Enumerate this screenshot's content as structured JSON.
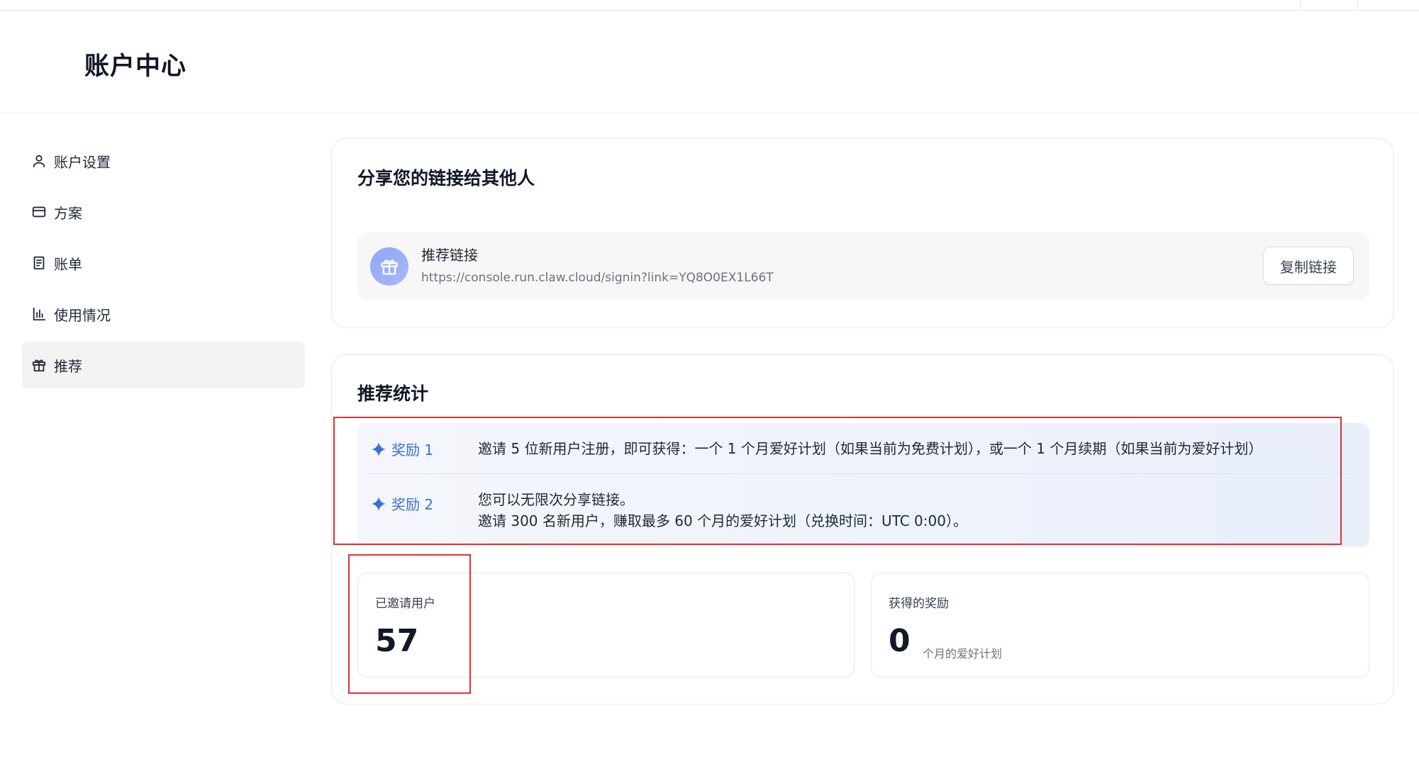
{
  "page": {
    "title": "账户中心"
  },
  "sidebar": {
    "items": [
      {
        "label": "账户设置",
        "icon": "user-icon",
        "active": false
      },
      {
        "label": "方案",
        "icon": "credit-card-icon",
        "active": false
      },
      {
        "label": "账单",
        "icon": "document-icon",
        "active": false
      },
      {
        "label": "使用情况",
        "icon": "bar-chart-icon",
        "active": false
      },
      {
        "label": "推荐",
        "icon": "gift-icon",
        "active": true
      }
    ]
  },
  "share": {
    "title": "分享您的链接给其他人",
    "referral_label": "推荐链接",
    "referral_url": "https://console.run.claw.cloud/signin?link=YQ8O0EX1L66T",
    "copy_button": "复制链接"
  },
  "stats": {
    "title": "推荐统计",
    "rewards": [
      {
        "tag": "奖励 1",
        "lines": [
          "邀请 5 位新用户注册，即可获得：一个 1 个月爱好计划（如果当前为免费计划），或一个 1 个月续期（如果当前为爱好计划）"
        ]
      },
      {
        "tag": "奖励 2",
        "lines": [
          "您可以无限次分享链接。",
          "邀请 300 名新用户，赚取最多 60 个月的爱好计划（兑换时间：UTC 0:00）。"
        ]
      }
    ],
    "invited": {
      "label": "已邀请用户",
      "value": "57"
    },
    "earned": {
      "label": "获得的奖励",
      "value": "0",
      "unit": "个月的爱好计划"
    }
  },
  "colors": {
    "accent": "#3b6fd8",
    "highlight": "#e0312f",
    "active_nav_bg": "#f2f2f3"
  }
}
